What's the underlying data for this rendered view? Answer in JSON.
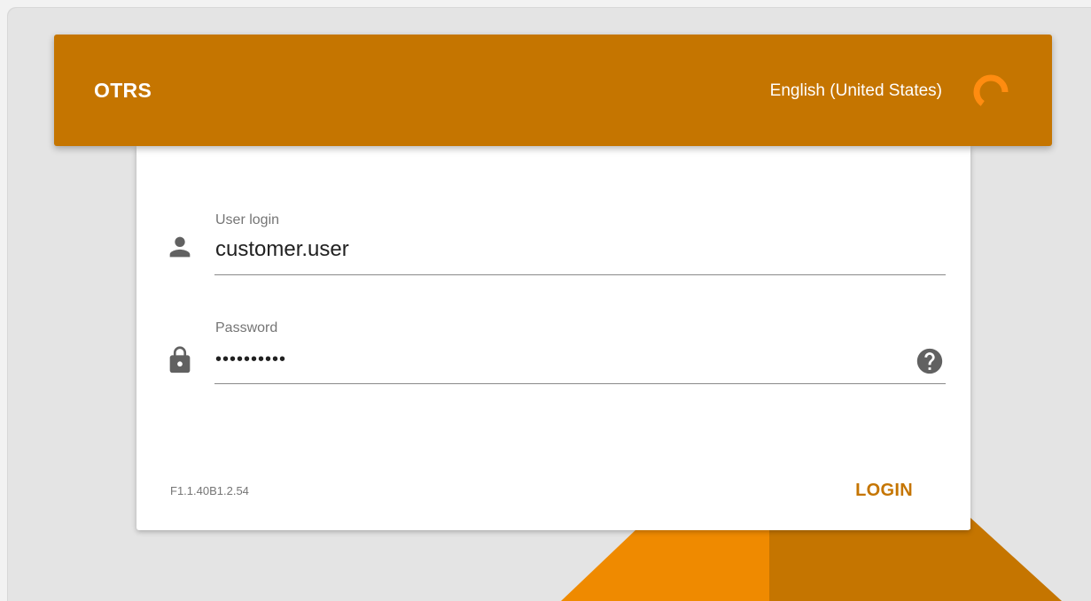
{
  "header": {
    "brand": "OTRS",
    "language": "English (United States)"
  },
  "login_form": {
    "user_label": "User login",
    "user_value": "customer.user",
    "password_label": "Password",
    "password_value": "••••••••••",
    "version": "F1.1.40B1.2.54",
    "login_button": "LOGIN"
  },
  "icons": {
    "user": "person-icon",
    "password": "lock-icon",
    "help": "question-circle-icon",
    "language": "loading-spinner-icon"
  },
  "colors": {
    "brand": "#c57500",
    "brand_light": "#ef8a00",
    "spinner": "#ff8c10",
    "background": "#e4e4e4",
    "card": "#ffffff"
  }
}
